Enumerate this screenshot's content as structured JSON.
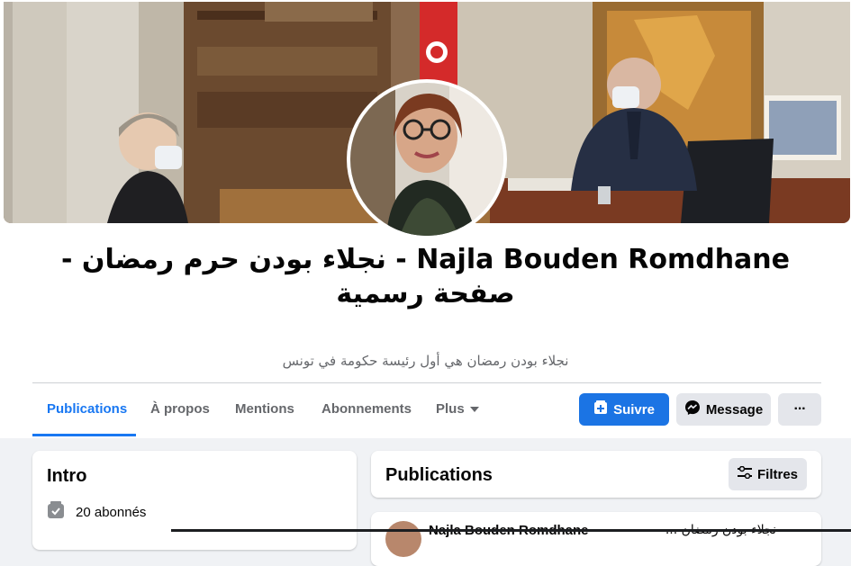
{
  "page": {
    "name": "Najla Bouden Romdhane - نجلاء بودن حرم رمضان - صفحة رسمية",
    "description": "نجلاء بودن رمضان هي أول رئيسة حكومة في تونس"
  },
  "tabs": [
    {
      "label": "Publications",
      "active": true
    },
    {
      "label": "À propos"
    },
    {
      "label": "Mentions"
    },
    {
      "label": "Abonnements"
    },
    {
      "label": "Plus"
    }
  ],
  "actions": {
    "follow": "Suivre",
    "message": "Message",
    "more": "···"
  },
  "intro": {
    "title": "Intro",
    "followers": "20 abonnés"
  },
  "publications": {
    "title": "Publications",
    "filters": "Filtres"
  },
  "post": {
    "author": "Najla Bouden Romdhane",
    "extra": "نجلاء بودن رمضان ..."
  },
  "colors": {
    "accent": "#1877f2",
    "follow_button": "#1b74e4",
    "secondary_button": "#e4e6eb",
    "background": "#f0f2f5"
  }
}
